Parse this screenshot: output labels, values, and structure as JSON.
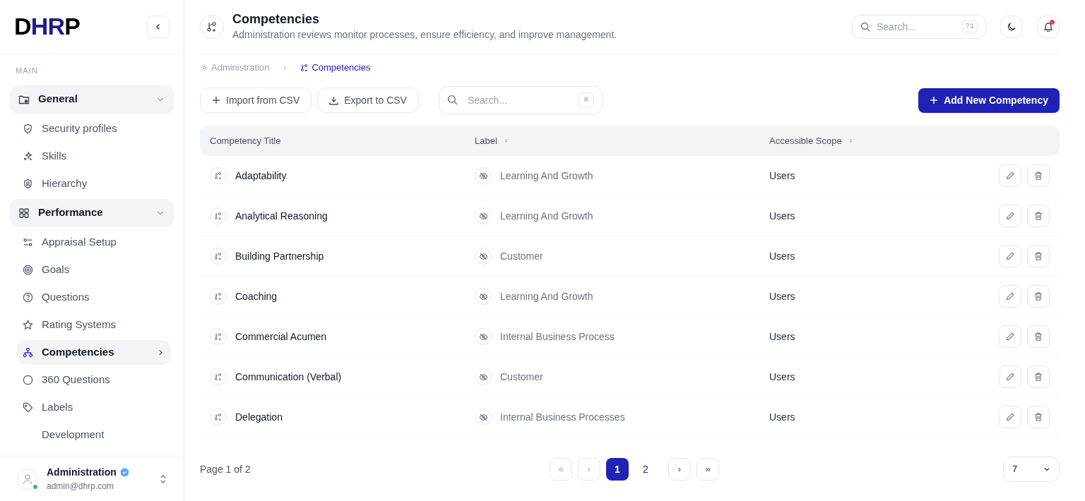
{
  "logo": [
    {
      "text": "D",
      "color": "#000000"
    },
    {
      "text": "HR",
      "color": "#1e1b8f"
    },
    {
      "text": "P",
      "color": "#000000"
    }
  ],
  "sidebar": {
    "section": "MAIN",
    "items": [
      {
        "label": "General",
        "kind": "group",
        "expanded": true,
        "selected": false,
        "children": [
          {
            "label": "Security profiles",
            "kind": "shield",
            "selected": false
          },
          {
            "label": "Skills",
            "kind": "sparkles",
            "selected": false
          },
          {
            "label": "Hierarchy",
            "kind": "badge",
            "selected": false
          }
        ]
      },
      {
        "label": "Performance",
        "kind": "group",
        "expanded": true,
        "selected": false,
        "children": [
          {
            "label": "Appraisal Setup",
            "kind": "sliders",
            "selected": false
          },
          {
            "label": "Goals",
            "kind": "target",
            "selected": false
          },
          {
            "label": "Questions",
            "kind": "help",
            "selected": false
          },
          {
            "label": "Rating Systems",
            "kind": "star",
            "selected": false
          },
          {
            "label": "Competencies",
            "kind": "network",
            "selected": true
          },
          {
            "label": "360 Questions",
            "kind": "circle",
            "selected": false
          },
          {
            "label": "Labels",
            "kind": "tag",
            "selected": false
          },
          {
            "label": "Development",
            "kind": "none",
            "selected": false
          }
        ]
      }
    ]
  },
  "user": {
    "name": "Administration",
    "email": "admin@dhrp.com",
    "verified": true,
    "online": true
  },
  "header": {
    "title": "Competencies",
    "subtitle": "Administration reviews monitor processes, ensure efficiency, and improve management.",
    "search_placeholder": "Search...",
    "shortcut": "?1",
    "has_notification": true
  },
  "breadcrumb": [
    "Administration",
    "Competencies"
  ],
  "toolbar": {
    "import": "Import from CSV",
    "export": "Export to CSV",
    "search_placeholder": "Search...",
    "shortcut": "⌘",
    "add": "Add New Competency"
  },
  "table": {
    "columns": [
      {
        "label": "Competency Title",
        "sortable": false
      },
      {
        "label": "Label",
        "sortable": true
      },
      {
        "label": "Accessible Scope",
        "sortable": true
      }
    ],
    "rows": [
      {
        "title": "Adaptability",
        "label": "Learning And Growth",
        "scope": "Users"
      },
      {
        "title": "Analytical Reasoning",
        "label": "Learning And Growth",
        "scope": "Users"
      },
      {
        "title": "Building Partnership",
        "label": "Customer",
        "scope": "Users"
      },
      {
        "title": "Coaching",
        "label": "Learning And Growth",
        "scope": "Users"
      },
      {
        "title": "Commercial Acumen",
        "label": "Internal Business Process",
        "scope": "Users"
      },
      {
        "title": "Communication (Verbal)",
        "label": "Customer",
        "scope": "Users"
      },
      {
        "title": "Delegation",
        "label": "Internal Business Processes",
        "scope": "Users"
      }
    ]
  },
  "pagination": {
    "summary": "Page 1 of 2",
    "first": "«",
    "prev": "‹",
    "pages": [
      {
        "label": "1",
        "selected": true
      },
      {
        "label": "2",
        "selected": false
      }
    ],
    "next": "›",
    "last": "»",
    "page_size": "7"
  }
}
